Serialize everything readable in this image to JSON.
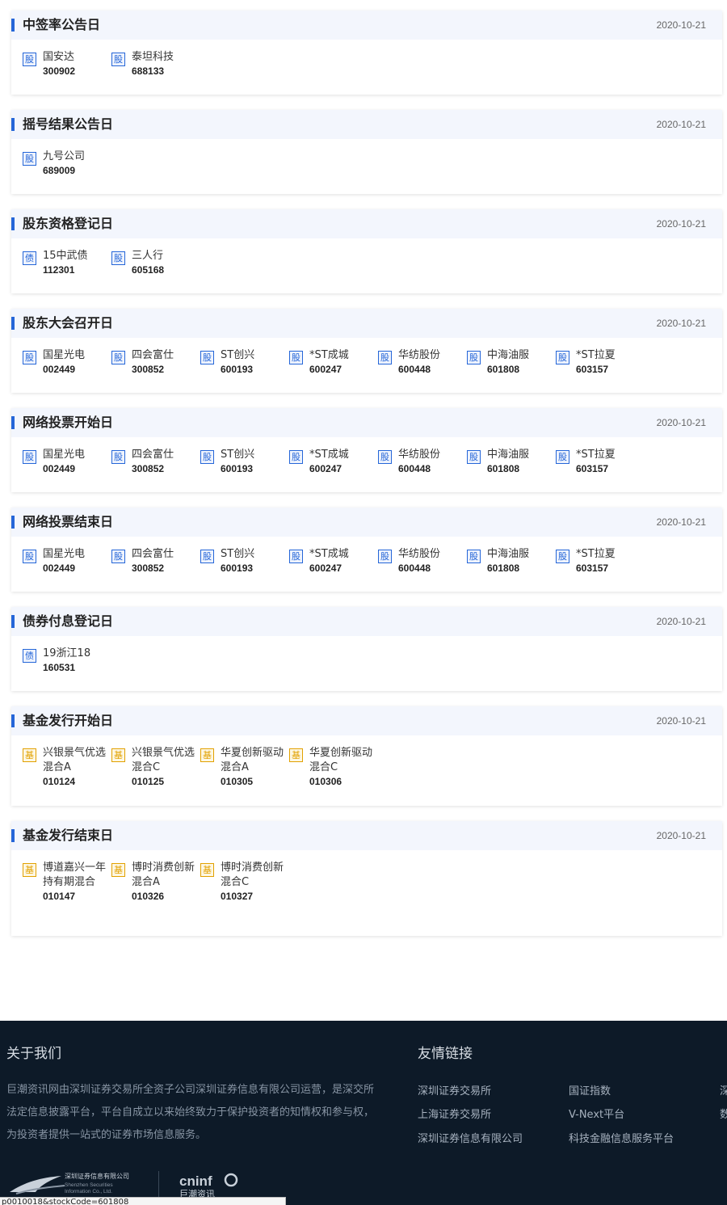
{
  "sections": [
    {
      "title": "中签率公告日",
      "date": "2020-10-21",
      "items": [
        {
          "type": "股",
          "name": "国安达",
          "code": "300902"
        },
        {
          "type": "股",
          "name": "泰坦科技",
          "code": "688133"
        }
      ]
    },
    {
      "title": "摇号结果公告日",
      "date": "2020-10-21",
      "items": [
        {
          "type": "股",
          "name": "九号公司",
          "code": "689009"
        }
      ]
    },
    {
      "title": "股东资格登记日",
      "date": "2020-10-21",
      "items": [
        {
          "type": "债",
          "name": "15中武债",
          "code": "112301"
        },
        {
          "type": "股",
          "name": "三人行",
          "code": "605168"
        }
      ]
    },
    {
      "title": "股东大会召开日",
      "date": "2020-10-21",
      "items": [
        {
          "type": "股",
          "name": "国星光电",
          "code": "002449"
        },
        {
          "type": "股",
          "name": "四会富仕",
          "code": "300852"
        },
        {
          "type": "股",
          "name": "ST创兴",
          "code": "600193"
        },
        {
          "type": "股",
          "name": "*ST成城",
          "code": "600247"
        },
        {
          "type": "股",
          "name": "华纺股份",
          "code": "600448"
        },
        {
          "type": "股",
          "name": "中海油服",
          "code": "601808"
        },
        {
          "type": "股",
          "name": "*ST拉夏",
          "code": "603157"
        }
      ]
    },
    {
      "title": "网络投票开始日",
      "date": "2020-10-21",
      "items": [
        {
          "type": "股",
          "name": "国星光电",
          "code": "002449"
        },
        {
          "type": "股",
          "name": "四会富仕",
          "code": "300852"
        },
        {
          "type": "股",
          "name": "ST创兴",
          "code": "600193"
        },
        {
          "type": "股",
          "name": "*ST成城",
          "code": "600247"
        },
        {
          "type": "股",
          "name": "华纺股份",
          "code": "600448"
        },
        {
          "type": "股",
          "name": "中海油服",
          "code": "601808"
        },
        {
          "type": "股",
          "name": "*ST拉夏",
          "code": "603157"
        }
      ]
    },
    {
      "title": "网络投票结束日",
      "date": "2020-10-21",
      "items": [
        {
          "type": "股",
          "name": "国星光电",
          "code": "002449"
        },
        {
          "type": "股",
          "name": "四会富仕",
          "code": "300852"
        },
        {
          "type": "股",
          "name": "ST创兴",
          "code": "600193"
        },
        {
          "type": "股",
          "name": "*ST成城",
          "code": "600247"
        },
        {
          "type": "股",
          "name": "华纺股份",
          "code": "600448"
        },
        {
          "type": "股",
          "name": "中海油服",
          "code": "601808"
        },
        {
          "type": "股",
          "name": "*ST拉夏",
          "code": "603157"
        }
      ]
    },
    {
      "title": "债券付息登记日",
      "date": "2020-10-21",
      "items": [
        {
          "type": "债",
          "name": "19浙江18",
          "code": "160531"
        }
      ]
    },
    {
      "title": "基金发行开始日",
      "date": "2020-10-21",
      "items": [
        {
          "type": "基",
          "name": "兴银景气优选混合A",
          "code": "010124"
        },
        {
          "type": "基",
          "name": "兴银景气优选混合C",
          "code": "010125"
        },
        {
          "type": "基",
          "name": "华夏创新驱动混合A",
          "code": "010305"
        },
        {
          "type": "基",
          "name": "华夏创新驱动混合C",
          "code": "010306"
        }
      ]
    },
    {
      "title": "基金发行结束日",
      "date": "2020-10-21",
      "items": [
        {
          "type": "基",
          "name": "博道嘉兴一年持有期混合",
          "code": "010147"
        },
        {
          "type": "基",
          "name": "博时消费创新混合A",
          "code": "010326"
        },
        {
          "type": "基",
          "name": "博时消费创新混合C",
          "code": "010327"
        }
      ]
    }
  ],
  "footer": {
    "about_title": "关于我们",
    "about_text": "巨潮资讯网由深圳证券交易所全资子公司深圳证券信息有限公司运营，是深交所法定信息披露平台，平台自成立以来始终致力于保护投资者的知情权和参与权，为投资者提供一站式的证券市场信息服务。",
    "links_title": "友情链接",
    "links": [
      "深圳证券交易所",
      "国证指数",
      "上海证券交易所",
      "V-Next平台",
      "深圳证券信息有限公司",
      "科技金融信息服务平台",
      "深",
      "数"
    ],
    "logo_a_cn": "深圳证券信息有限公司",
    "logo_a_en1": "Shenzhen Securities",
    "logo_a_en2": "Information Co., Ltd.",
    "logo_b_en": "cninf",
    "logo_b_cn": "巨潮资讯"
  },
  "status_url": "p0010018&stockCode=601808"
}
